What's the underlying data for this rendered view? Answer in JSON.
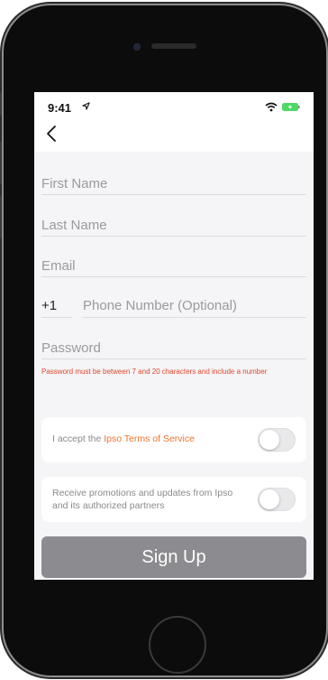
{
  "status_bar": {
    "time": "9:41"
  },
  "form": {
    "first_name_placeholder": "First Name",
    "last_name_placeholder": "Last Name",
    "email_placeholder": "Email",
    "country_code": "+1",
    "phone_placeholder": "Phone Number (Optional)",
    "password_placeholder": "Password",
    "password_hint": "Password must be between 7 and 20 characters and include a number"
  },
  "terms": {
    "prefix": "I accept the ",
    "link": "Ipso Terms of Service",
    "enabled": false
  },
  "promotions": {
    "text": "Receive promotions and updates from Ipso and its authorized partners",
    "enabled": false
  },
  "signup_label": "Sign Up",
  "colors": {
    "accent": "#f0722d",
    "error": "#e0472a",
    "button": "#8c8b90",
    "background": "#f5f4f6"
  }
}
